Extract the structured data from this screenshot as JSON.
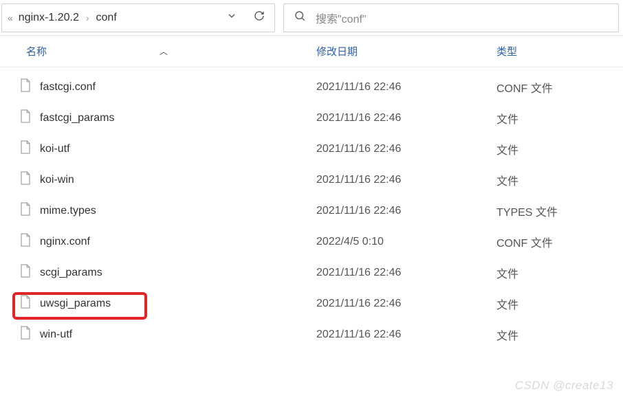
{
  "breadcrumb": {
    "segments": [
      "nginx-1.20.2",
      "conf"
    ]
  },
  "search": {
    "placeholder": "搜索\"conf\""
  },
  "columns": {
    "name": "名称",
    "date": "修改日期",
    "type": "类型"
  },
  "files": [
    {
      "name": "fastcgi.conf",
      "date": "2021/11/16 22:46",
      "type": "CONF 文件",
      "highlighted": false
    },
    {
      "name": "fastcgi_params",
      "date": "2021/11/16 22:46",
      "type": "文件",
      "highlighted": false
    },
    {
      "name": "koi-utf",
      "date": "2021/11/16 22:46",
      "type": "文件",
      "highlighted": false
    },
    {
      "name": "koi-win",
      "date": "2021/11/16 22:46",
      "type": "文件",
      "highlighted": false
    },
    {
      "name": "mime.types",
      "date": "2021/11/16 22:46",
      "type": "TYPES 文件",
      "highlighted": false
    },
    {
      "name": "nginx.conf",
      "date": "2022/4/5 0:10",
      "type": "CONF 文件",
      "highlighted": true
    },
    {
      "name": "scgi_params",
      "date": "2021/11/16 22:46",
      "type": "文件",
      "highlighted": false
    },
    {
      "name": "uwsgi_params",
      "date": "2021/11/16 22:46",
      "type": "文件",
      "highlighted": false
    },
    {
      "name": "win-utf",
      "date": "2021/11/16 22:46",
      "type": "文件",
      "highlighted": false
    }
  ],
  "watermark": "CSDN @create13"
}
